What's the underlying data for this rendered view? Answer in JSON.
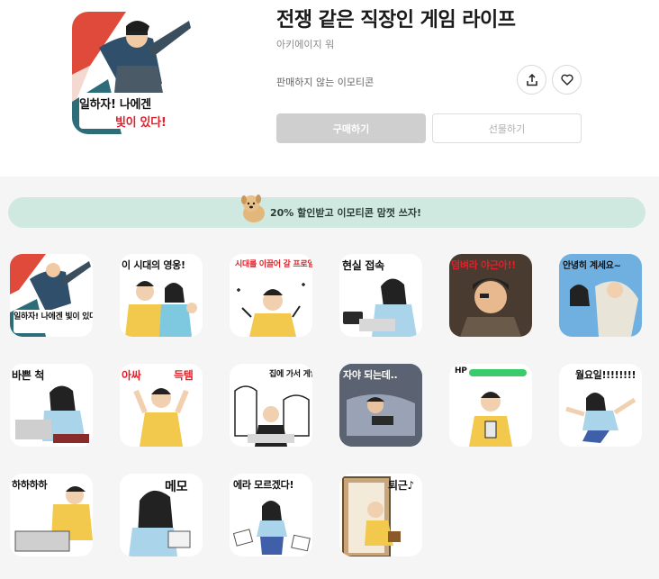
{
  "header": {
    "title": "전쟁 같은 직장인 게임 라이프",
    "author": "아키에이지 워",
    "not_for_sale": "판매하지 않는 이모티콘",
    "buy_label": "구매하기",
    "gift_label": "선물하기",
    "share_icon": "share-icon",
    "like_icon": "heart-icon",
    "cover_caption_line1": "일하자! 나에겐",
    "cover_caption_line2": "빛이 있다!"
  },
  "promo": {
    "text": "20% 할인받고 이모티콘 맘껏 쓰자!",
    "background": "#cfe9e0"
  },
  "stickers": [
    {
      "caption": "일하자! 나에겐 빛이 있다!"
    },
    {
      "caption": "이 시대의 영웅!"
    },
    {
      "caption": "시대를 이끌어 갈 프로일잘러!"
    },
    {
      "caption": "현실 접속"
    },
    {
      "caption": "덤벼라 야근아!!"
    },
    {
      "caption": "안녕히 계세요~"
    },
    {
      "caption": "바쁜 척"
    },
    {
      "caption_left": "아싸",
      "caption_right": "득템"
    },
    {
      "caption": "집에 가서 게임하고 싶다"
    },
    {
      "caption": "자야 되는데.."
    },
    {
      "caption": "HP"
    },
    {
      "caption": "월요일!!!!!!!!"
    },
    {
      "caption": "하하하하"
    },
    {
      "caption": "메모"
    },
    {
      "caption": "에라 모르겠다!"
    },
    {
      "caption": "퇴근♪"
    }
  ]
}
